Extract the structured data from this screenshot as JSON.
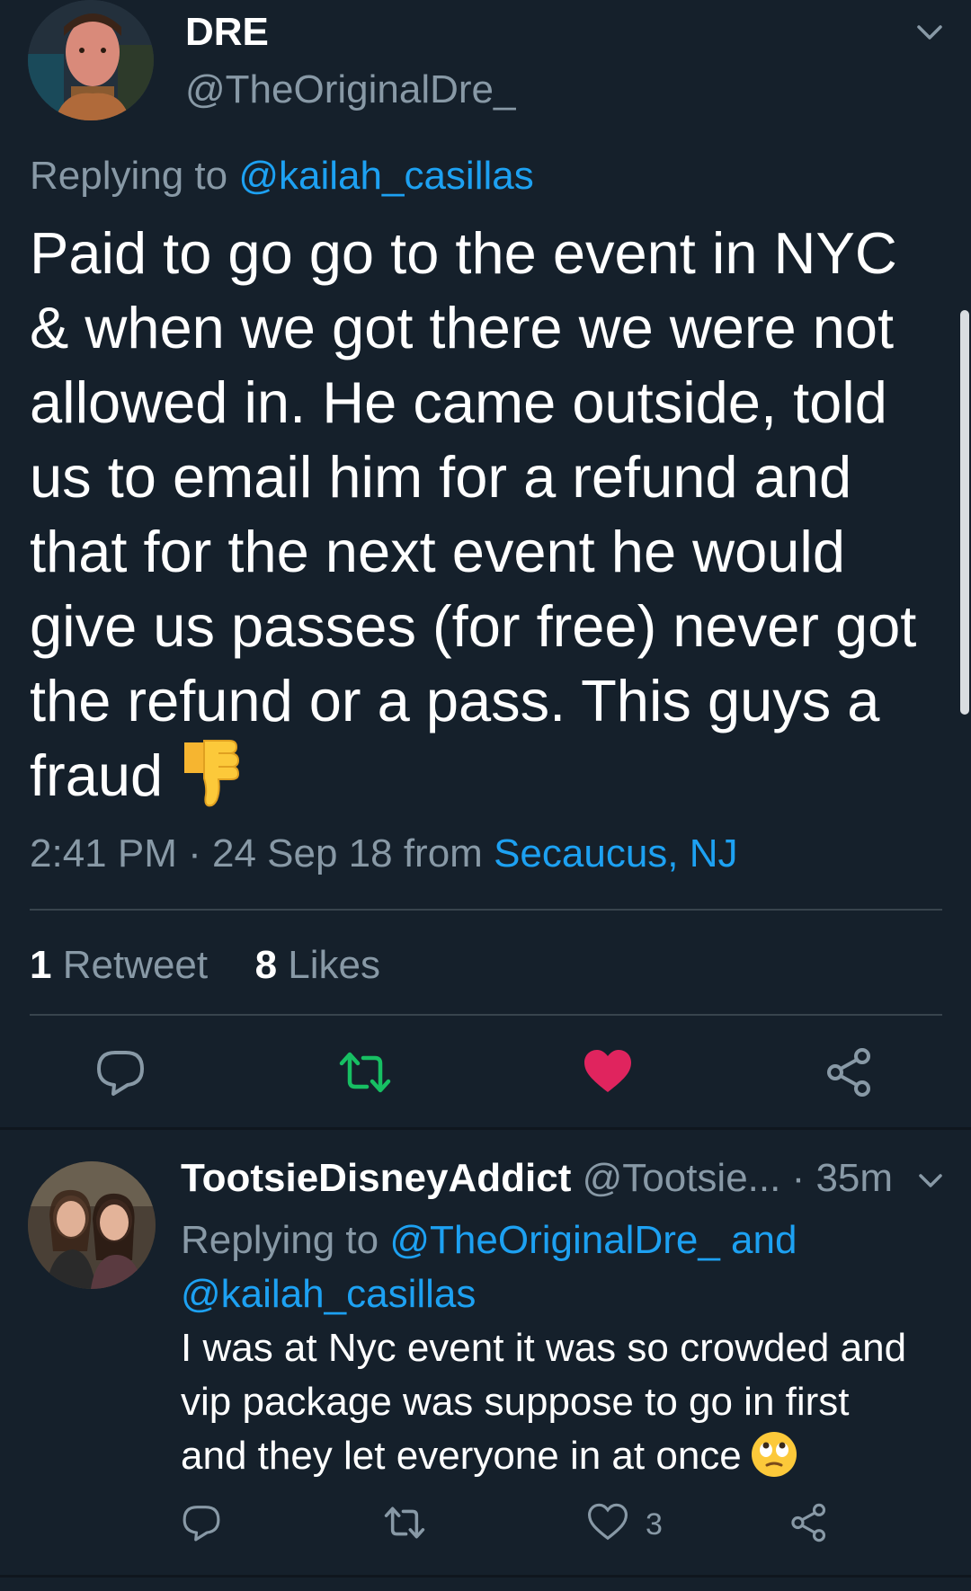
{
  "main_tweet": {
    "display_name": "DRE",
    "handle": "@TheOriginalDre_",
    "replying_prefix": "Replying to ",
    "replying_to": "@kailah_casillas",
    "text_lines": [
      "Paid to go go to the event in NYC",
      "& when we got there we were not",
      "allowed in. He came outside, told",
      "us to email him for a refund and",
      "that for the next event he would",
      "give us passes (for free) never got",
      "the refund or a pass. This guys a",
      "fraud"
    ],
    "emoji": "thumbs-down",
    "time": "2:41 PM",
    "separator": " · ",
    "date": "24 Sep 18",
    "from_prefix": " from ",
    "location": "Secaucus, NJ",
    "retweet_count": "1",
    "retweet_label": " Retweet",
    "like_count": "8",
    "like_label": " Likes",
    "liked": true
  },
  "reply": {
    "display_name": "TootsieDisneyAddict",
    "handle": " @Tootsie...",
    "time": " · 35m",
    "replying_prefix": "Replying to ",
    "replying_to_1": "@TheOriginalDre_",
    "replying_joiner": " and",
    "replying_to_2": "@kailah_casillas",
    "text_lines": [
      "I was at Nyc event it was so crowded and",
      "vip package was suppose to go in first",
      "and they let everyone in at once"
    ],
    "emoji": "face-with-rolling-eyes",
    "like_count": "3"
  },
  "colors": {
    "background": "#15202b",
    "secondary_text": "#8899a6",
    "link": "#1da1f2",
    "retweet_green": "#17bf63",
    "like_red": "#e0245e",
    "divider": "#38444d"
  },
  "icons": [
    "caret-down-icon",
    "reply-icon",
    "retweet-icon",
    "heart-icon",
    "share-icon"
  ]
}
